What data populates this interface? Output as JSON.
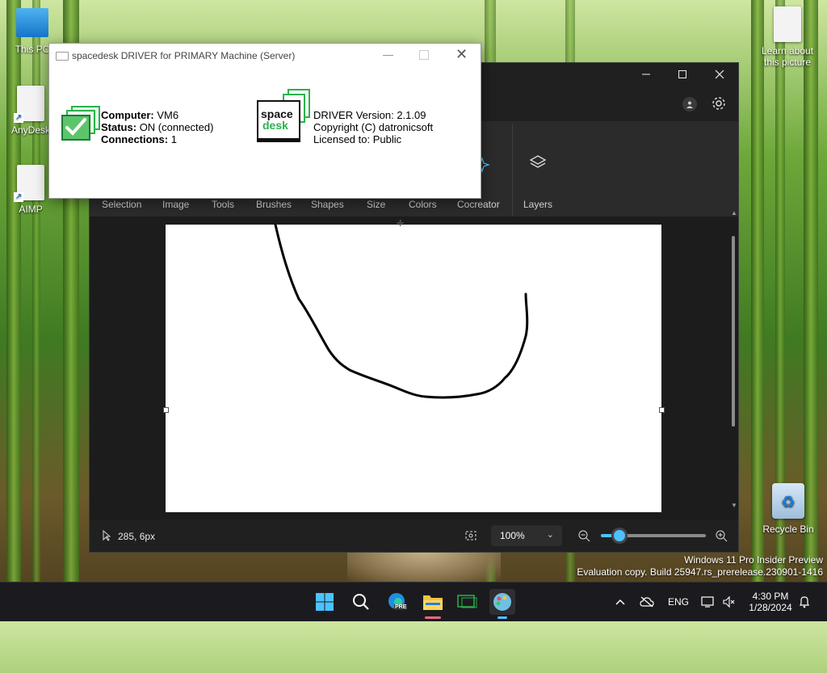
{
  "desktop": {
    "icons": [
      {
        "label": "This PC"
      },
      {
        "label": "AnyDesk"
      },
      {
        "label": "AIMP"
      },
      {
        "label": "Learn about this picture"
      },
      {
        "label": "Recycle Bin"
      }
    ],
    "watermark_line1": "Windows 11 Pro Insider Preview",
    "watermark_line2": "Evaluation copy. Build 25947.rs_prerelease.230901-1416"
  },
  "spacedesk": {
    "title": "spacedesk DRIVER for PRIMARY Machine (Server)",
    "computer_label": "Computer:",
    "computer_value": "VM6",
    "status_label": "Status:",
    "status_value": "ON (connected)",
    "connections_label": "Connections:",
    "connections_value": "1",
    "logo_line1": "space",
    "logo_line2": "desk",
    "version": "DRIVER Version: 2.1.09",
    "copyright": "Copyright (C) datronicsoft",
    "licensed": "Licensed to:  Public"
  },
  "paint": {
    "ribbon": [
      "Selection",
      "Image",
      "Tools",
      "Brushes",
      "Shapes",
      "Size",
      "Colors",
      "Cocreator",
      "Layers"
    ],
    "cursor_position": "285, 6px",
    "zoom": "100%",
    "zoom_slider_value": 0.18
  },
  "taskbar": {
    "edge_badge": "PRE",
    "language": "ENG",
    "time": "4:30 PM",
    "date": "1/28/2024"
  },
  "colors": {
    "accent": "#4cc2ff",
    "paint_bg": "#202020",
    "taskbar_bg": "#1b1b1f",
    "spacedesk_green": "#2bb24c"
  }
}
